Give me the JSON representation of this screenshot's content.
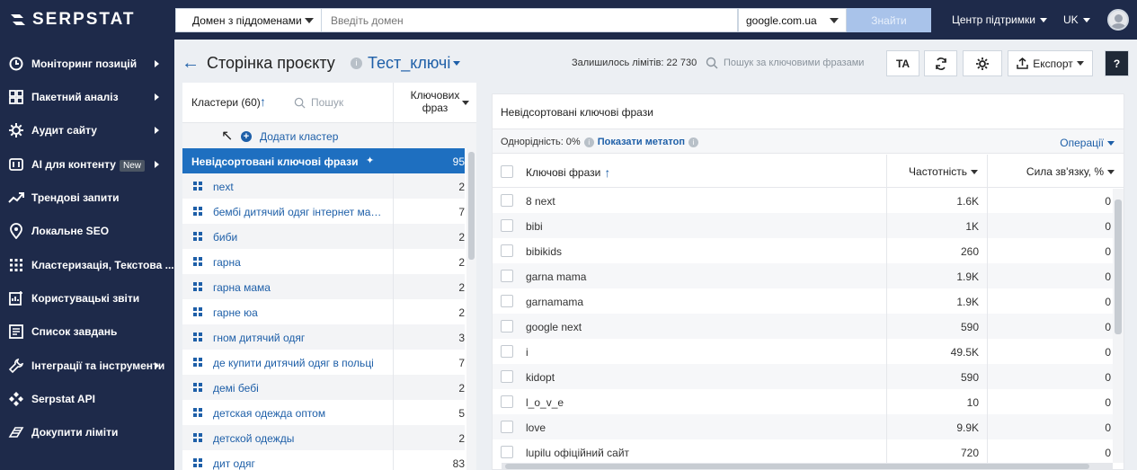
{
  "app": {
    "logo": "SERPSTAT"
  },
  "topbar": {
    "domain_mode": "Домен з піддоменами",
    "domain_placeholder": "Введіть домен",
    "search_engine": "google.com.ua",
    "find_button": "Знайти",
    "support": "Центр підтримки",
    "language": "UK"
  },
  "sidebar": {
    "items": [
      {
        "label": "Моніторинг позицій",
        "icon": "chart-icon",
        "arrow": true
      },
      {
        "label": "Пакетний аналіз",
        "icon": "grid-icon",
        "arrow": true
      },
      {
        "label": "Аудит сайту",
        "icon": "gear-icon",
        "arrow": true
      },
      {
        "label": "AI для контенту",
        "icon": "ai-icon",
        "arrow": true,
        "badge": "New"
      },
      {
        "label": "Трендові запити",
        "icon": "trend-icon",
        "arrow": false
      },
      {
        "label": "Локальне SEO",
        "icon": "pin-icon",
        "arrow": false
      },
      {
        "label": "Кластеризація, Текстова ...",
        "icon": "dots-icon",
        "arrow": false
      },
      {
        "label": "Користувацькі звіти",
        "icon": "report-icon",
        "arrow": false
      },
      {
        "label": "Список завдань",
        "icon": "list-icon",
        "arrow": false
      },
      {
        "label": "Інтеграції та інструменти",
        "icon": "wrench-icon",
        "arrow": true
      },
      {
        "label": "Serpstat API",
        "icon": "api-icon",
        "arrow": false
      },
      {
        "label": "Докупити ліміти",
        "icon": "cart-icon",
        "arrow": false
      }
    ]
  },
  "header": {
    "title": "Сторінка проєкту",
    "info": "i",
    "project": "Тест_ключі",
    "limits": "Залишилось лімітів: 22 730",
    "kw_search": "Пошук за ключовими фразами",
    "ta_button": "TA",
    "export_button": "Експорт",
    "help_button": "?"
  },
  "clusters": {
    "title": "Кластери (60)",
    "search_placeholder": "Пошук",
    "col_header_1": "Ключових",
    "col_header_2": "фраз",
    "add_cluster": "Додати кластер",
    "rows": [
      {
        "name": "Невідсортовані ключові фрази",
        "count": "95",
        "active": true
      },
      {
        "name": "next",
        "count": "2"
      },
      {
        "name": "бембі дитячий одяг інтернет мага...",
        "count": "7"
      },
      {
        "name": "биби",
        "count": "2"
      },
      {
        "name": "гарна",
        "count": "2"
      },
      {
        "name": "гарна мама",
        "count": "2"
      },
      {
        "name": "гарне юа",
        "count": "2"
      },
      {
        "name": "гном дитячий одяг",
        "count": "3"
      },
      {
        "name": "де купити дитячий одяг в польці",
        "count": "7"
      },
      {
        "name": "демі бебі",
        "count": "2"
      },
      {
        "name": "детская одежда оптом",
        "count": "5"
      },
      {
        "name": "детской одежды",
        "count": "2"
      },
      {
        "name": "дит одяг",
        "count": "83"
      }
    ]
  },
  "keywords": {
    "title": "Невідсортовані ключові фрази",
    "homogeneity": "Однорідність: 0%",
    "show_meta": "Показати метатоп",
    "operations": "Операції",
    "col_kw": "Ключові фрази",
    "col_freq": "Частотність",
    "col_rel": "Сила зв'язку, %",
    "rows": [
      {
        "kw": "8 next",
        "freq": "1.6K",
        "rel": "0"
      },
      {
        "kw": "bibi",
        "freq": "1K",
        "rel": "0"
      },
      {
        "kw": "bibikids",
        "freq": "260",
        "rel": "0"
      },
      {
        "kw": "garna mama",
        "freq": "1.9K",
        "rel": "0"
      },
      {
        "kw": "garnamama",
        "freq": "1.9K",
        "rel": "0"
      },
      {
        "kw": "google next",
        "freq": "590",
        "rel": "0"
      },
      {
        "kw": "i",
        "freq": "49.5K",
        "rel": "0"
      },
      {
        "kw": "kidopt",
        "freq": "590",
        "rel": "0"
      },
      {
        "kw": "l_o_v_e",
        "freq": "10",
        "rel": "0"
      },
      {
        "kw": "love",
        "freq": "9.9K",
        "rel": "0"
      },
      {
        "kw": "lupilu офіційний сайт",
        "freq": "720",
        "rel": "0"
      }
    ]
  }
}
